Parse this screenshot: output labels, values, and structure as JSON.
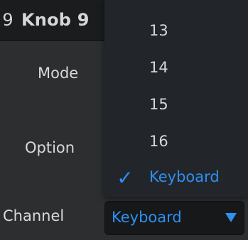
{
  "knob": {
    "index": "9",
    "name": "Knob 9"
  },
  "labels": {
    "mode": "Mode",
    "option": "Option",
    "channel": "Channel"
  },
  "channel_dropdown": {
    "options": [
      "13",
      "14",
      "15",
      "16",
      "Keyboard"
    ],
    "selected_index": 4,
    "checkmark": "✓",
    "value": "Keyboard",
    "arrow_icon": "triangle-down-icon"
  },
  "colors": {
    "accent": "#2f8ff0",
    "menu_bg": "#22262b",
    "panel_bg": "#2c2e30"
  }
}
